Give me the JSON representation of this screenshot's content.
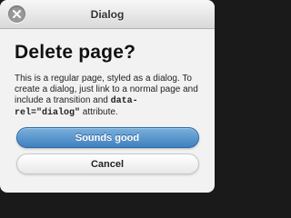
{
  "dialog": {
    "header_title": "Dialog",
    "close_icon": "close-icon",
    "title": "Delete page?",
    "body_text": "This is a regular page, styled as a dialog. To create a dialog, just link to a normal page and include a transition and ",
    "body_code": "data-rel=\"dialog\"",
    "body_suffix": " attribute.",
    "primary_button_label": "Sounds good",
    "secondary_button_label": "Cancel"
  },
  "colors": {
    "primary_button": "#3f80c0",
    "header": "#d9d9d9",
    "background": "#f2f2f2"
  }
}
